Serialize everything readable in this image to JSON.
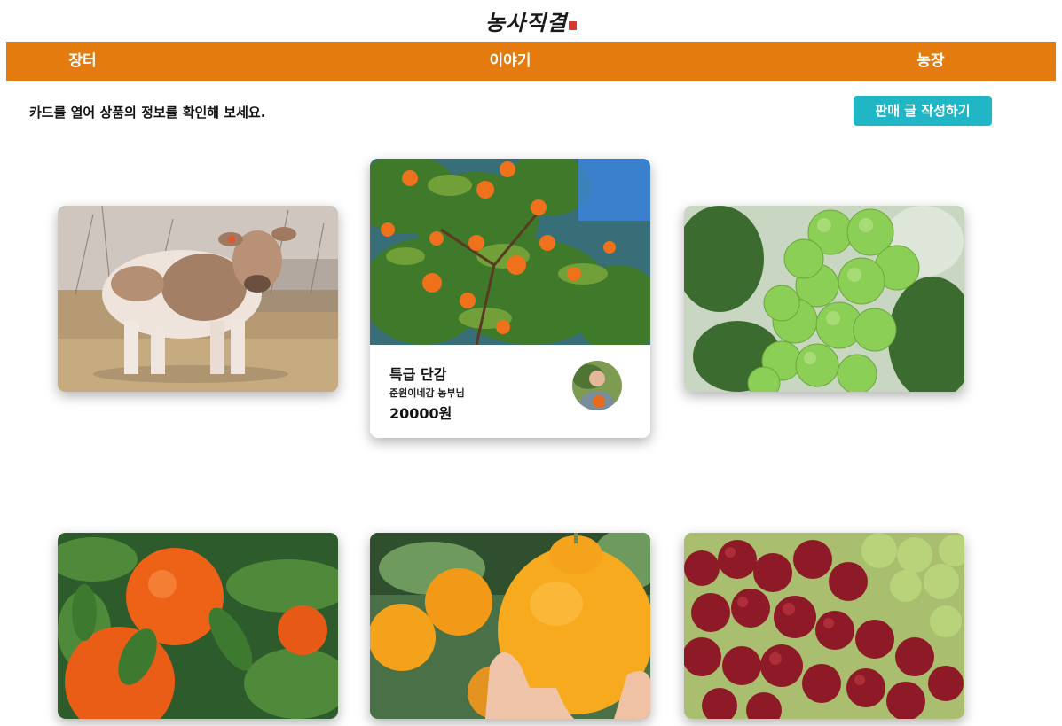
{
  "header": {
    "logo_text": "농사직결"
  },
  "nav": {
    "items": [
      {
        "label": "장터"
      },
      {
        "label": "이야기"
      },
      {
        "label": "농장"
      }
    ]
  },
  "main": {
    "hint": "카드를 열어 상품의 정보를 확인해 보세요.",
    "write_button": "판매 글 작성하기"
  },
  "products": [
    {
      "image": "calf"
    },
    {
      "image": "persimmon-tree",
      "title": "특급 단감",
      "farmer": "준원이네감 농부님",
      "price": "20000원"
    },
    {
      "image": "green-plums"
    },
    {
      "image": "tangerines"
    },
    {
      "image": "hallabong"
    },
    {
      "image": "grapes"
    }
  ]
}
